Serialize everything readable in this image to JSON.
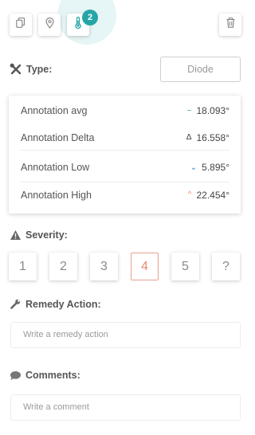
{
  "toolbar": {
    "icons": [
      "copy-icon",
      "location-pin-icon",
      "thermometer-icon",
      "trash-icon"
    ],
    "badge_count": "2",
    "accent_color": "#26a5a8"
  },
  "type": {
    "label": "Type:",
    "value": "Diode"
  },
  "annotations": [
    {
      "label": "Annotation avg",
      "symbol": "~",
      "value": "18.093°",
      "symbol_color": "#26a5a8"
    },
    {
      "label": "Annotation Delta",
      "symbol": "Δ",
      "value": "16.558°",
      "symbol_color": "#333333"
    },
    {
      "label": "Annotation Low",
      "symbol": "⌄",
      "value": "5.895°",
      "symbol_color": "#2a8fd6"
    },
    {
      "label": "Annotation High",
      "symbol": "^",
      "value": "22.454°",
      "symbol_color": "#e58a6a"
    }
  ],
  "severity": {
    "label": "Severity:",
    "options": [
      "1",
      "2",
      "3",
      "4",
      "5",
      "?"
    ],
    "selected": "4",
    "selected_color": "#e58a6a"
  },
  "remedy": {
    "label": "Remedy Action:",
    "placeholder": "Write a remedy action"
  },
  "comments": {
    "label": "Comments:",
    "placeholder": "Write a comment"
  }
}
